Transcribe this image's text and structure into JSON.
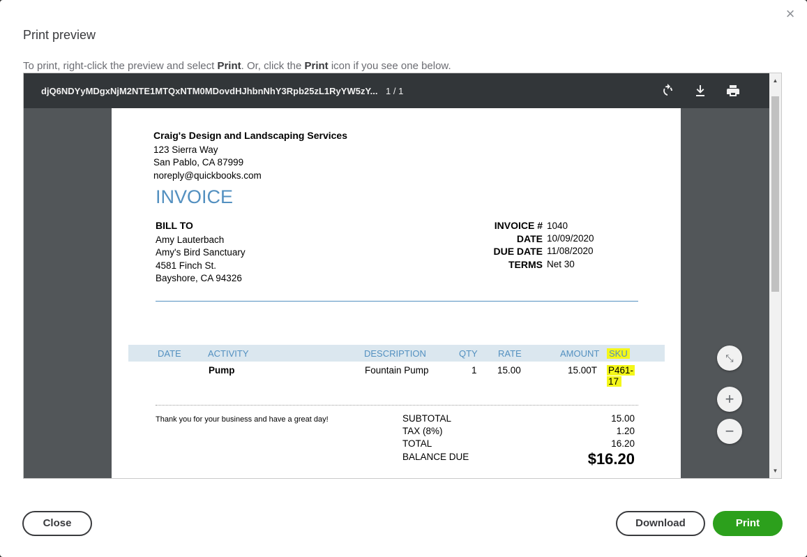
{
  "dialog": {
    "title": "Print preview",
    "close_glyph": "×",
    "instructions": {
      "part1": "To print, right-click the preview and select ",
      "bold1": "Print",
      "part2": ". Or, click the ",
      "bold2": "Print",
      "part3": " icon if you see one below."
    }
  },
  "pdf_viewer": {
    "filename": "djQ6NDYyMDgxNjM2NTE1MTQxNTM0MDovdHJhbnNhY3Rpb25zL1RyYW5zY...",
    "page_indicator": "1 / 1",
    "icons": [
      "rotate-icon",
      "download-icon",
      "print-icon"
    ],
    "zoom_in_glyph": "+",
    "zoom_out_glyph": "−",
    "fit_glyph": "⤡"
  },
  "invoice": {
    "company": {
      "name": "Craig's Design and Landscaping Services",
      "address1": "123 Sierra Way",
      "address2": "San Pablo, CA  87999",
      "email": "noreply@quickbooks.com"
    },
    "title": "INVOICE",
    "bill_to": {
      "label": "BILL TO",
      "name": "Amy Lauterbach",
      "company": "Amy's Bird Sanctuary",
      "address1": "4581 Finch St.",
      "address2": "Bayshore, CA  94326"
    },
    "meta": {
      "invoice_label": "INVOICE #",
      "invoice_value": "1040",
      "date_label": "DATE",
      "date_value": "10/09/2020",
      "due_label": "DUE DATE",
      "due_value": "11/08/2020",
      "terms_label": "TERMS",
      "terms_value": "Net 30"
    },
    "table": {
      "headers": [
        "DATE",
        "ACTIVITY",
        "DESCRIPTION",
        "QTY",
        "RATE",
        "AMOUNT",
        "SKU"
      ],
      "rows": [
        {
          "date": "",
          "activity": "Pump",
          "description": "Fountain Pump",
          "qty": "1",
          "rate": "15.00",
          "amount": "15.00T",
          "sku_line1": "P461-",
          "sku_line2": "17"
        }
      ]
    },
    "thanks": "Thank you for your business and have a great day!",
    "totals": {
      "subtotal_label": "SUBTOTAL",
      "subtotal_value": "15.00",
      "tax_label": "TAX (8%)",
      "tax_value": "1.20",
      "total_label": "TOTAL",
      "total_value": "16.20",
      "balance_label": "BALANCE DUE",
      "balance_value": "$16.20"
    }
  },
  "footer": {
    "close_label": "Close",
    "download_label": "Download",
    "print_label": "Print"
  },
  "colors": {
    "accent_blue": "#5390c0",
    "print_green": "#2ca01c",
    "highlight": "#f4f71a"
  }
}
